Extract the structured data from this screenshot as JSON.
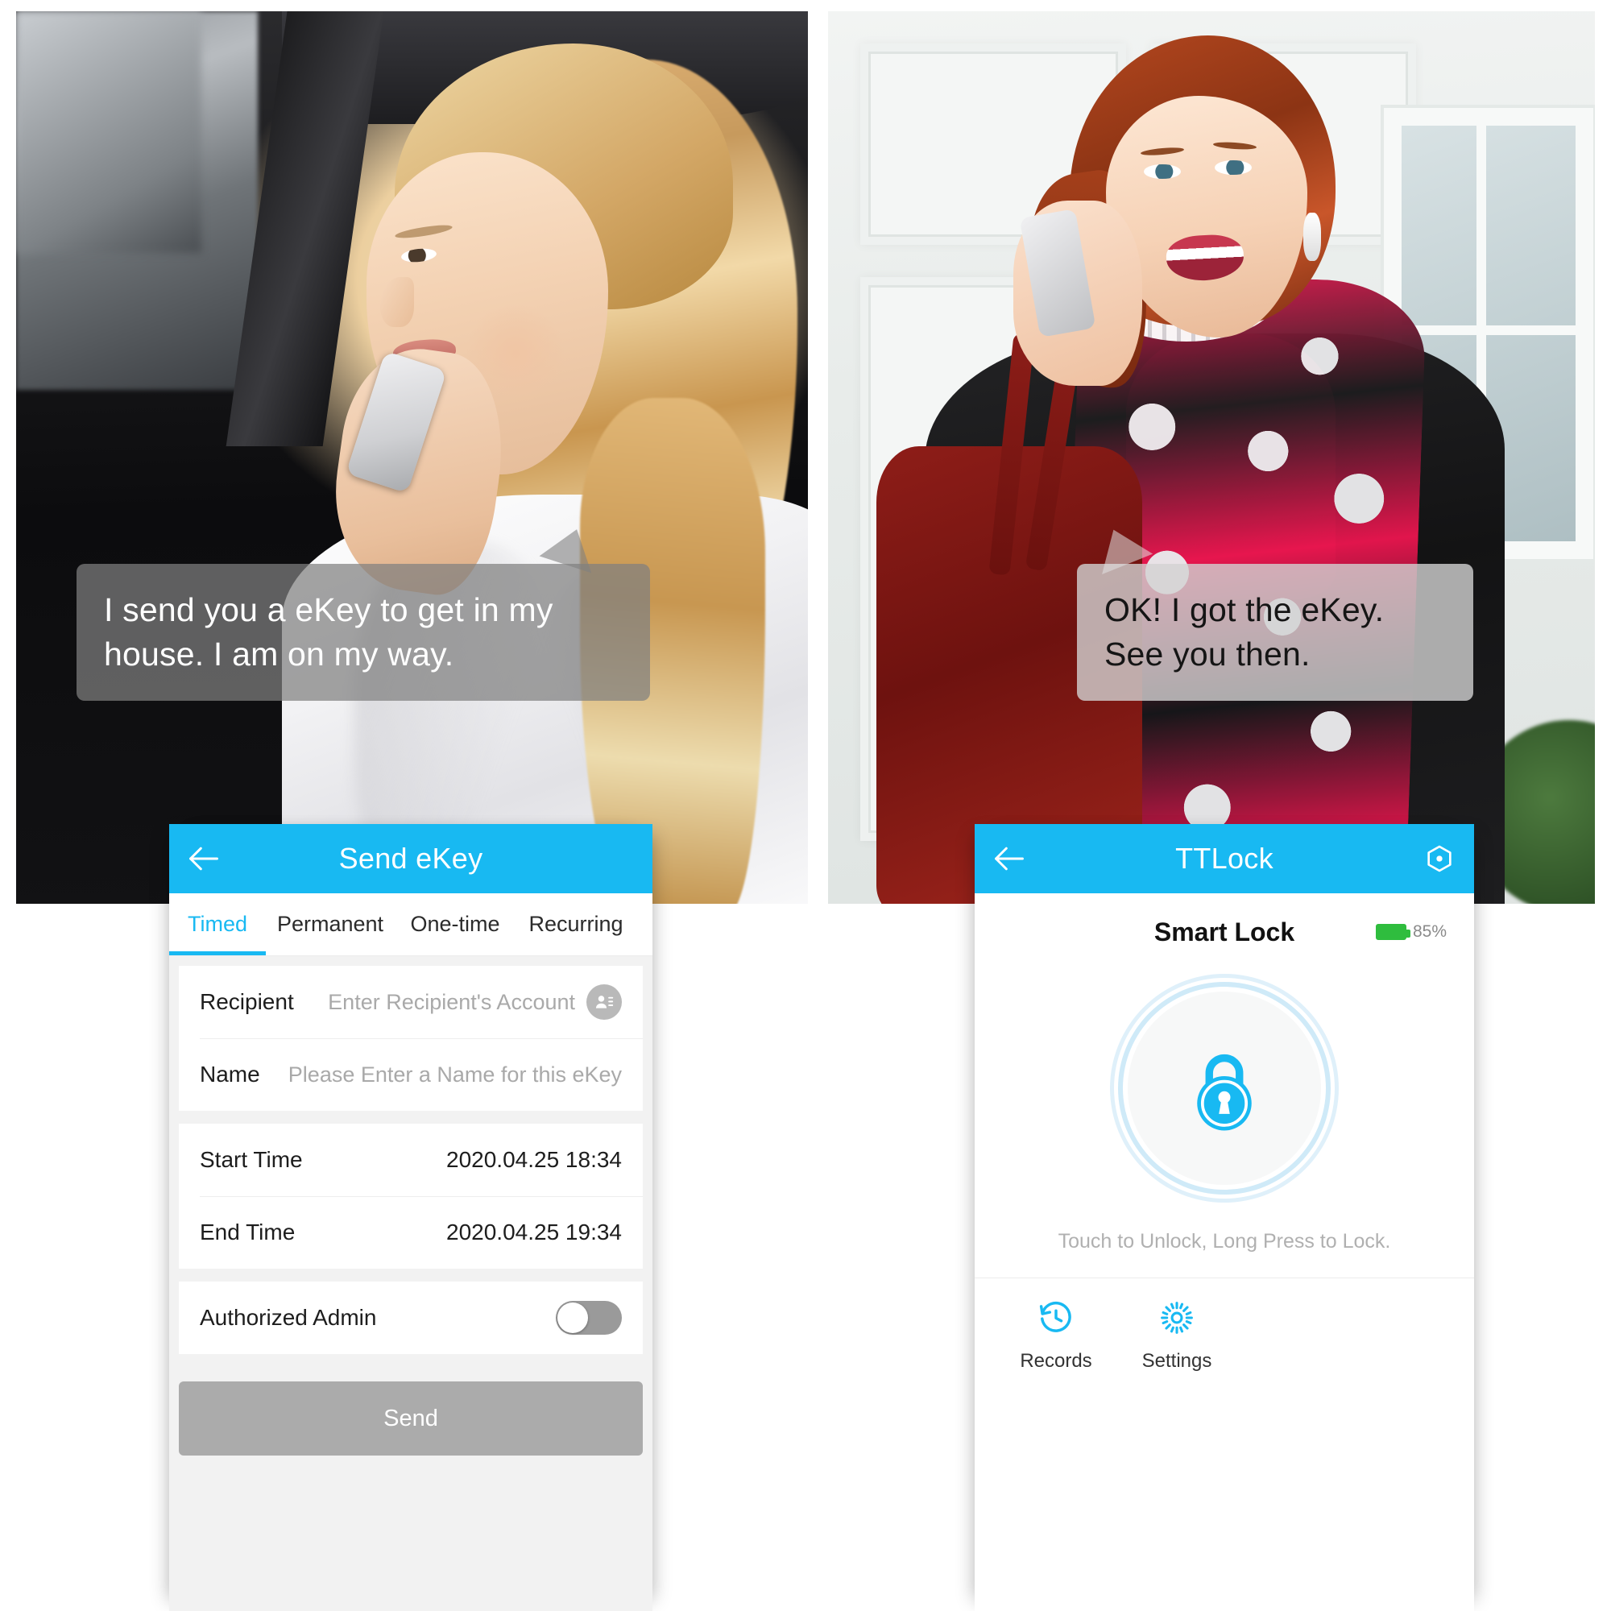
{
  "scenes": {
    "left": {
      "bubble_text": "I send you a eKey to get in my house. I am on my way.",
      "alt": "woman-in-car-on-phone"
    },
    "right": {
      "bubble_text": "OK! I got the eKey. See you then.",
      "alt": "woman-at-door-on-phone"
    }
  },
  "send_ekey_screen": {
    "appbar": {
      "title": "Send eKey",
      "back_icon": "back-arrow-icon"
    },
    "tabs": [
      {
        "label": "Timed",
        "active": true
      },
      {
        "label": "Permanent",
        "active": false
      },
      {
        "label": "One-time",
        "active": false
      },
      {
        "label": "Recurring",
        "active": false
      }
    ],
    "fields": {
      "recipient": {
        "label": "Recipient",
        "placeholder": "Enter Recipient's Account",
        "value": "",
        "contact_icon": "contact-card-icon"
      },
      "name": {
        "label": "Name",
        "placeholder": "Please Enter a Name for this eKey",
        "value": ""
      },
      "start_time": {
        "label": "Start Time",
        "value": "2020.04.25 18:34"
      },
      "end_time": {
        "label": "End Time",
        "value": "2020.04.25 19:34"
      },
      "authorized_admin": {
        "label": "Authorized Admin",
        "state": "off"
      }
    },
    "send_button": {
      "label": "Send",
      "enabled": false
    },
    "colors": {
      "accent": "#18b9f2",
      "disabled_button": "#ababab",
      "page_bg": "#f2f2f2"
    }
  },
  "ttlock_screen": {
    "appbar": {
      "title": "TTLock",
      "back_icon": "back-arrow-icon",
      "right_icon": "hexagon-dot-icon"
    },
    "lock": {
      "name": "Smart Lock",
      "battery_percent": "85%",
      "battery_icon": "battery-icon",
      "lock_icon": "padlock-icon",
      "hint": "Touch to Unlock, Long Press to Lock."
    },
    "actions": [
      {
        "label": "Records",
        "icon": "history-clock-icon"
      },
      {
        "label": "Settings",
        "icon": "gear-icon"
      }
    ],
    "colors": {
      "accent": "#18b9f2",
      "battery_green": "#2fbd3e",
      "hint_gray": "#b0b0b0"
    }
  }
}
